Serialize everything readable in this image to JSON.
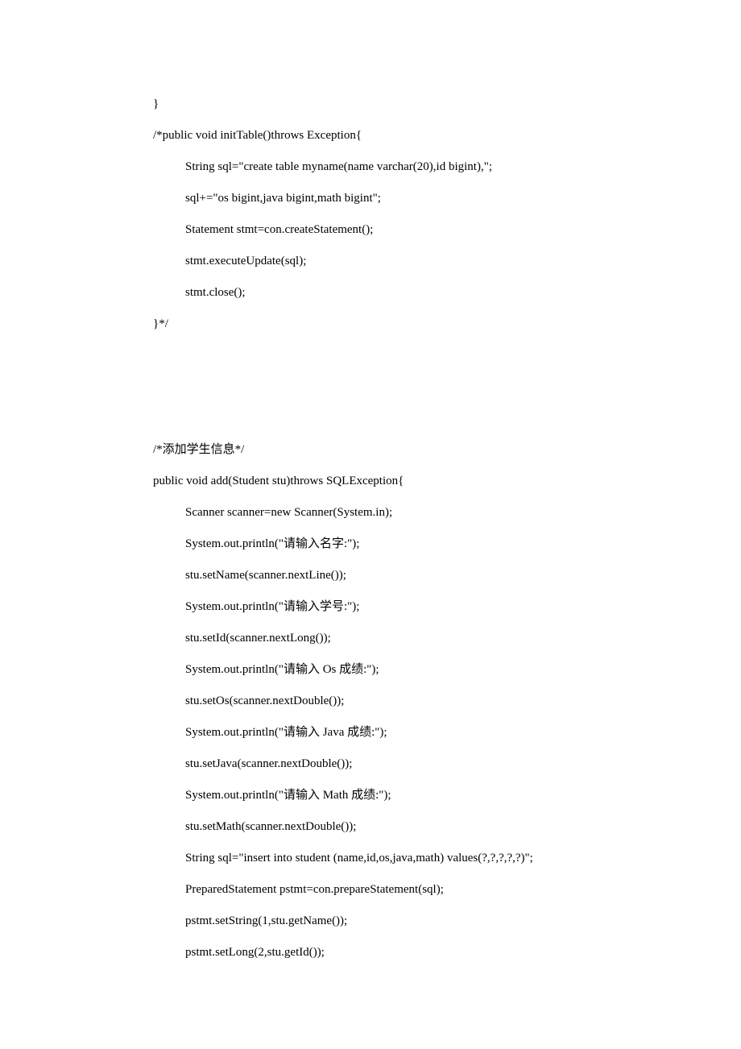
{
  "lines": [
    {
      "indent": 0,
      "text": "}"
    },
    {
      "indent": 0,
      "text": "/*public void initTable()throws Exception{"
    },
    {
      "indent": 1,
      "text": "String sql=\"create table myname(name varchar(20),id bigint),\";"
    },
    {
      "indent": 1,
      "text": "sql+=\"os bigint,java bigint,math bigint\";"
    },
    {
      "indent": 1,
      "text": "Statement stmt=con.createStatement();"
    },
    {
      "indent": 1,
      "text": "stmt.executeUpdate(sql);"
    },
    {
      "indent": 1,
      "text": "stmt.close();"
    },
    {
      "indent": 0,
      "text": "}*/"
    },
    {
      "blank": true
    },
    {
      "blank": true
    },
    {
      "blank": true
    },
    {
      "indent": 0,
      "text": "/*添加学生信息*/"
    },
    {
      "indent": 0,
      "text": "public void add(Student stu)throws SQLException{"
    },
    {
      "indent": 1,
      "text": "Scanner scanner=new Scanner(System.in);"
    },
    {
      "indent": 1,
      "text": "System.out.println(\"请输入名字:\");"
    },
    {
      "indent": 1,
      "text": "stu.setName(scanner.nextLine());"
    },
    {
      "indent": 1,
      "text": "System.out.println(\"请输入学号:\");"
    },
    {
      "indent": 1,
      "text": "stu.setId(scanner.nextLong());"
    },
    {
      "indent": 1,
      "text": "System.out.println(\"请输入 Os 成绩:\");"
    },
    {
      "indent": 1,
      "text": "stu.setOs(scanner.nextDouble());"
    },
    {
      "indent": 1,
      "text": "System.out.println(\"请输入 Java 成绩:\");"
    },
    {
      "indent": 1,
      "text": "stu.setJava(scanner.nextDouble());"
    },
    {
      "indent": 1,
      "text": "System.out.println(\"请输入 Math 成绩:\");"
    },
    {
      "indent": 1,
      "text": "stu.setMath(scanner.nextDouble());"
    },
    {
      "indent": 1,
      "text": "String sql=\"insert into student (name,id,os,java,math) values(?,?,?,?,?)\";"
    },
    {
      "indent": 1,
      "text": "PreparedStatement pstmt=con.prepareStatement(sql);"
    },
    {
      "indent": 1,
      "text": "pstmt.setString(1,stu.getName());"
    },
    {
      "indent": 1,
      "text": "pstmt.setLong(2,stu.getId());"
    }
  ]
}
